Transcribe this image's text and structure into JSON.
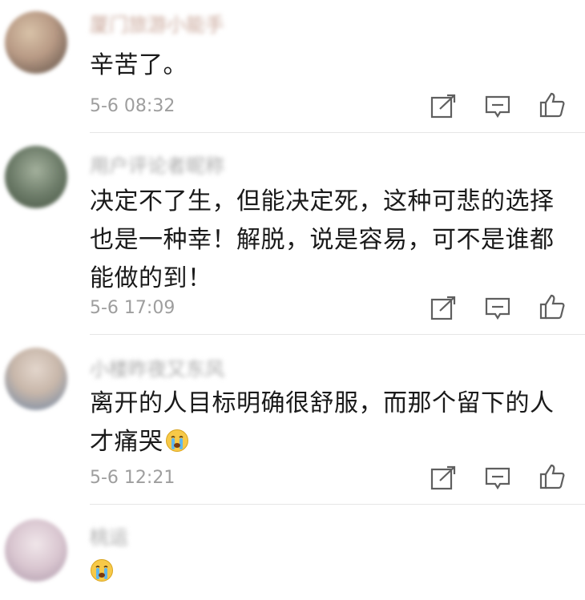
{
  "comments": [
    {
      "username": "厦门旅游小能手",
      "text": "辛苦了。",
      "time": "5-6 08:32",
      "avatar_colors": [
        "#b89a85",
        "#6a5a4f",
        "#d8c2a8"
      ]
    },
    {
      "username": "用户评论者昵称",
      "text": "决定不了生，但能决定死，这种可悲的选择也是一种幸！解脱，说是容易，可不是谁都能做的到！",
      "time": "5-6 17:09",
      "avatar_colors": [
        "#6e7d6a",
        "#a3b09c",
        "#4d5c4a"
      ]
    },
    {
      "username": "小楼昨夜又东风",
      "text": "离开的人目标明确很舒服，而那个留下的人才痛哭",
      "time": "5-6 12:21",
      "avatar_colors": [
        "#c8b7aa",
        "#7d8ea5",
        "#e3d6cc"
      ]
    },
    {
      "username": "桃运",
      "text": "",
      "time": "",
      "avatar_colors": [
        "#d9c6d0",
        "#b4a0b0",
        "#f0e6ea"
      ]
    }
  ],
  "actions": {
    "share_icon": "share-icon",
    "comment_icon": "comment-icon",
    "like_icon": "like-icon"
  },
  "emoji": "crying-face-emoji"
}
